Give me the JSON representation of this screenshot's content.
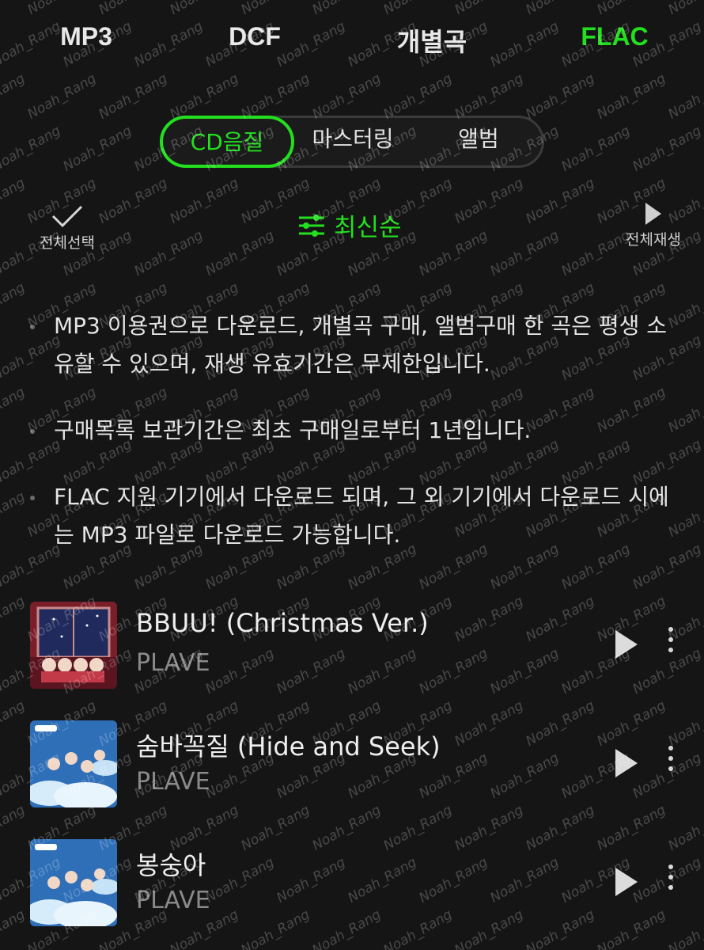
{
  "top_tabs": [
    {
      "label": "MP3",
      "active": false
    },
    {
      "label": "DCF",
      "active": false
    },
    {
      "label": "개별곡",
      "active": false
    },
    {
      "label": "FLAC",
      "active": true
    }
  ],
  "quality_segments": [
    {
      "label": "CD음질",
      "active": true
    },
    {
      "label": "마스터링",
      "active": false
    },
    {
      "label": "앨범",
      "active": false
    }
  ],
  "actions": {
    "select_all_label": "전체선택",
    "sort_label": "최신순",
    "play_all_label": "전체재생"
  },
  "notices": [
    "MP3 이용권으로 다운로드, 개별곡 구매, 앨범구매 한 곡은 평생 소유할 수 있으며, 재생 유효기간은 무제한입니다.",
    "구매목록 보관기간은 최초 구매일로부터 1년입니다.",
    "FLAC 지원 기기에서 다운로드 되며, 그 외 기기에서 다운로드 시에는 MP3 파일로 다운로드 가능합니다."
  ],
  "tracks": [
    {
      "title": "BBUU! (Christmas Ver.)",
      "artist": "PLAVE",
      "cover": "christmas-cover"
    },
    {
      "title": "숨바꼭질 (Hide and Seek)",
      "artist": "PLAVE",
      "cover": "sky-cover"
    },
    {
      "title": "봉숭아",
      "artist": "PLAVE",
      "cover": "sky-cover"
    }
  ],
  "watermark_text": "Noah_Rang",
  "colors": {
    "accent": "#22e01e",
    "background": "#151515",
    "text": "#e6e6e6",
    "muted": "#8a8a8a"
  }
}
